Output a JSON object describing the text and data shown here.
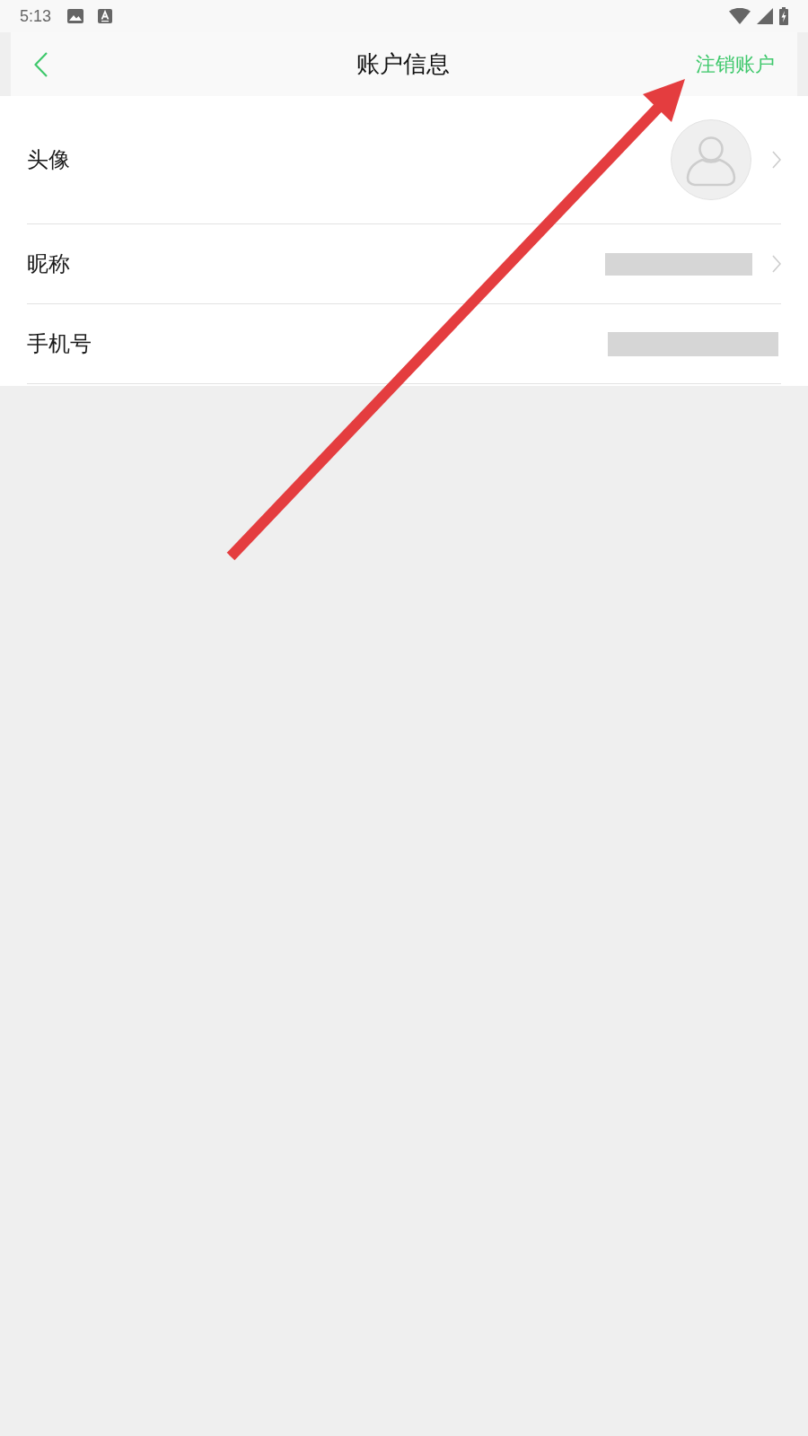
{
  "status_bar": {
    "time": "5:13"
  },
  "header": {
    "title": "账户信息",
    "action": "注销账户"
  },
  "rows": [
    {
      "kind": "avatar",
      "label": "头像",
      "chevron": true
    },
    {
      "kind": "value",
      "label": "昵称",
      "chevron": true
    },
    {
      "kind": "value",
      "label": "手机号",
      "chevron": false
    }
  ]
}
